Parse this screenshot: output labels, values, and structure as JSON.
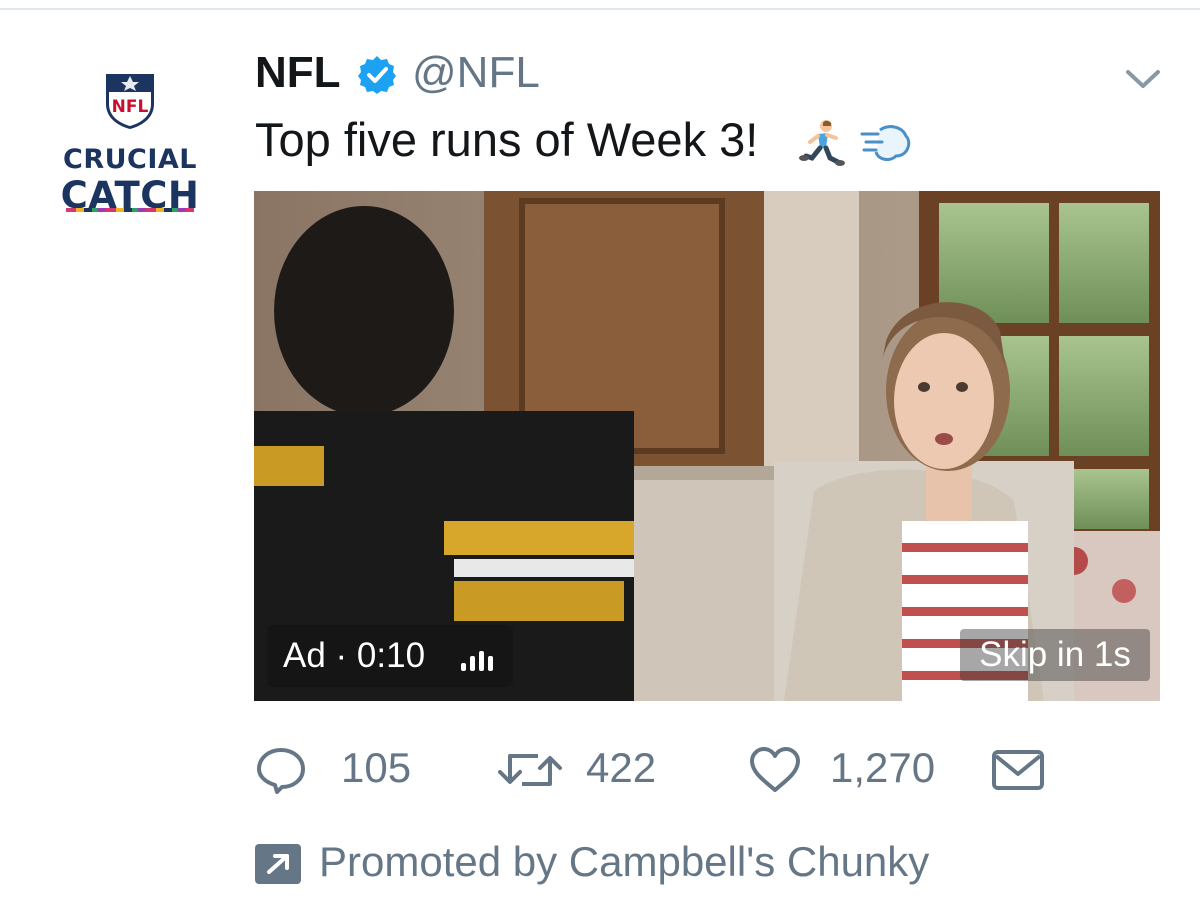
{
  "tweet": {
    "author_name": "NFL",
    "author_handle": "@NFL",
    "verified": true,
    "text": "Top five runs of Week 3!",
    "emojis": [
      "person-running-emoji",
      "dash-symbol-emoji"
    ]
  },
  "avatar": {
    "shield_text": "NFL",
    "line1": "CRUCIAL",
    "line2": "CATCH"
  },
  "video": {
    "ad_label": "Ad · 0:10",
    "skip_label": "Skip in 1s"
  },
  "actions": {
    "replies": "105",
    "retweets": "422",
    "likes": "1,270"
  },
  "promoted": {
    "text": "Promoted by Campbell's Chunky"
  },
  "colors": {
    "text_primary": "#14171a",
    "text_secondary": "#657786",
    "verified_blue": "#1da1f2",
    "nfl_navy": "#1b3560"
  }
}
